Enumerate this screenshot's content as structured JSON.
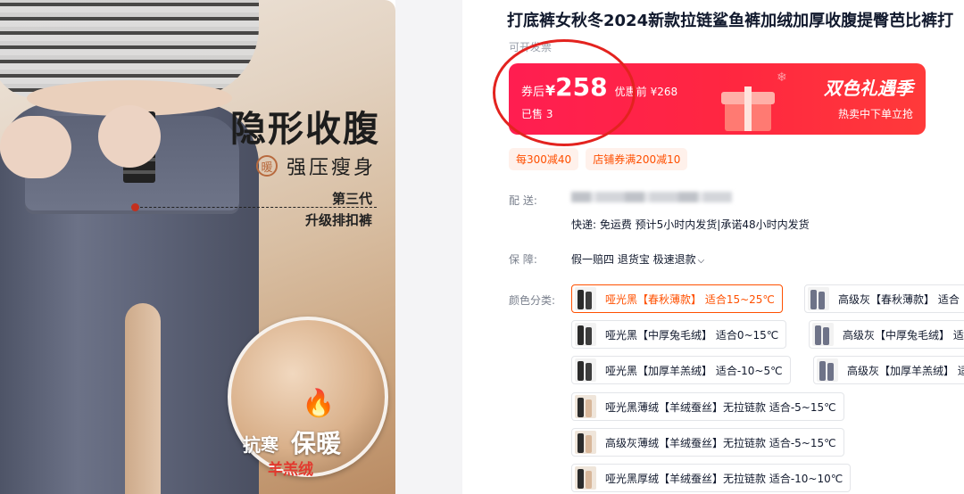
{
  "product_image": {
    "headline": "隐形收腹",
    "warm_badge": "暖",
    "subheadline": "强压瘦身",
    "generation": "第三代",
    "generation_sub": "升级排扣裤",
    "cold_label": "抗寒",
    "warm_label": "保暖",
    "wool_label": "羊羔绒"
  },
  "product": {
    "title": "打底裤女秋冬2024新款拉链鲨鱼裤加绒加厚收腹提臀芭比裤打",
    "invoice_note": "可开发票"
  },
  "price_banner": {
    "after_coupon_label": "券后",
    "currency": "¥",
    "price": "258",
    "pre_discount_label": "优惠前",
    "original_price": "¥268",
    "sold": "已售 3",
    "season_title": "双色礼遇季",
    "season_sub": "热卖中下单立抢",
    "background_color": "#ff2442"
  },
  "coupons": [
    "每300减40",
    "店铺券满200减10"
  ],
  "delivery": {
    "label": "配    送:",
    "shipping": "快递: 免运费  预计5小时内发货|承诺48小时内发货"
  },
  "guarantee": {
    "label": "保    障:",
    "value": "假一赔四 退货宝 极速退款"
  },
  "color_options": {
    "label": "颜色分类:",
    "items": [
      {
        "label": "哑光黑【春秋薄款】 适合15~25℃",
        "selected": true
      },
      {
        "label": "高级灰【春秋薄款】 适合",
        "selected": false
      },
      {
        "label": "哑光黑【中厚兔毛绒】 适合0~15℃",
        "selected": false
      },
      {
        "label": "高级灰【中厚兔毛绒】 适",
        "selected": false
      },
      {
        "label": "哑光黑【加厚羊羔绒】 适合-10~5℃",
        "selected": false
      },
      {
        "label": "高级灰【加厚羊羔绒】 适",
        "selected": false
      },
      {
        "label": "哑光黑薄绒【羊绒蚕丝】无拉链款 适合-5~15℃",
        "selected": false
      },
      {
        "label": "高级灰薄绒【羊绒蚕丝】无拉链款 适合-5~15℃",
        "selected": false
      },
      {
        "label": "哑光黑厚绒【羊绒蚕丝】无拉链款 适合-10~10℃",
        "selected": false
      }
    ]
  },
  "accent_color": "#ff5000",
  "annotation_color": "#e3231f"
}
